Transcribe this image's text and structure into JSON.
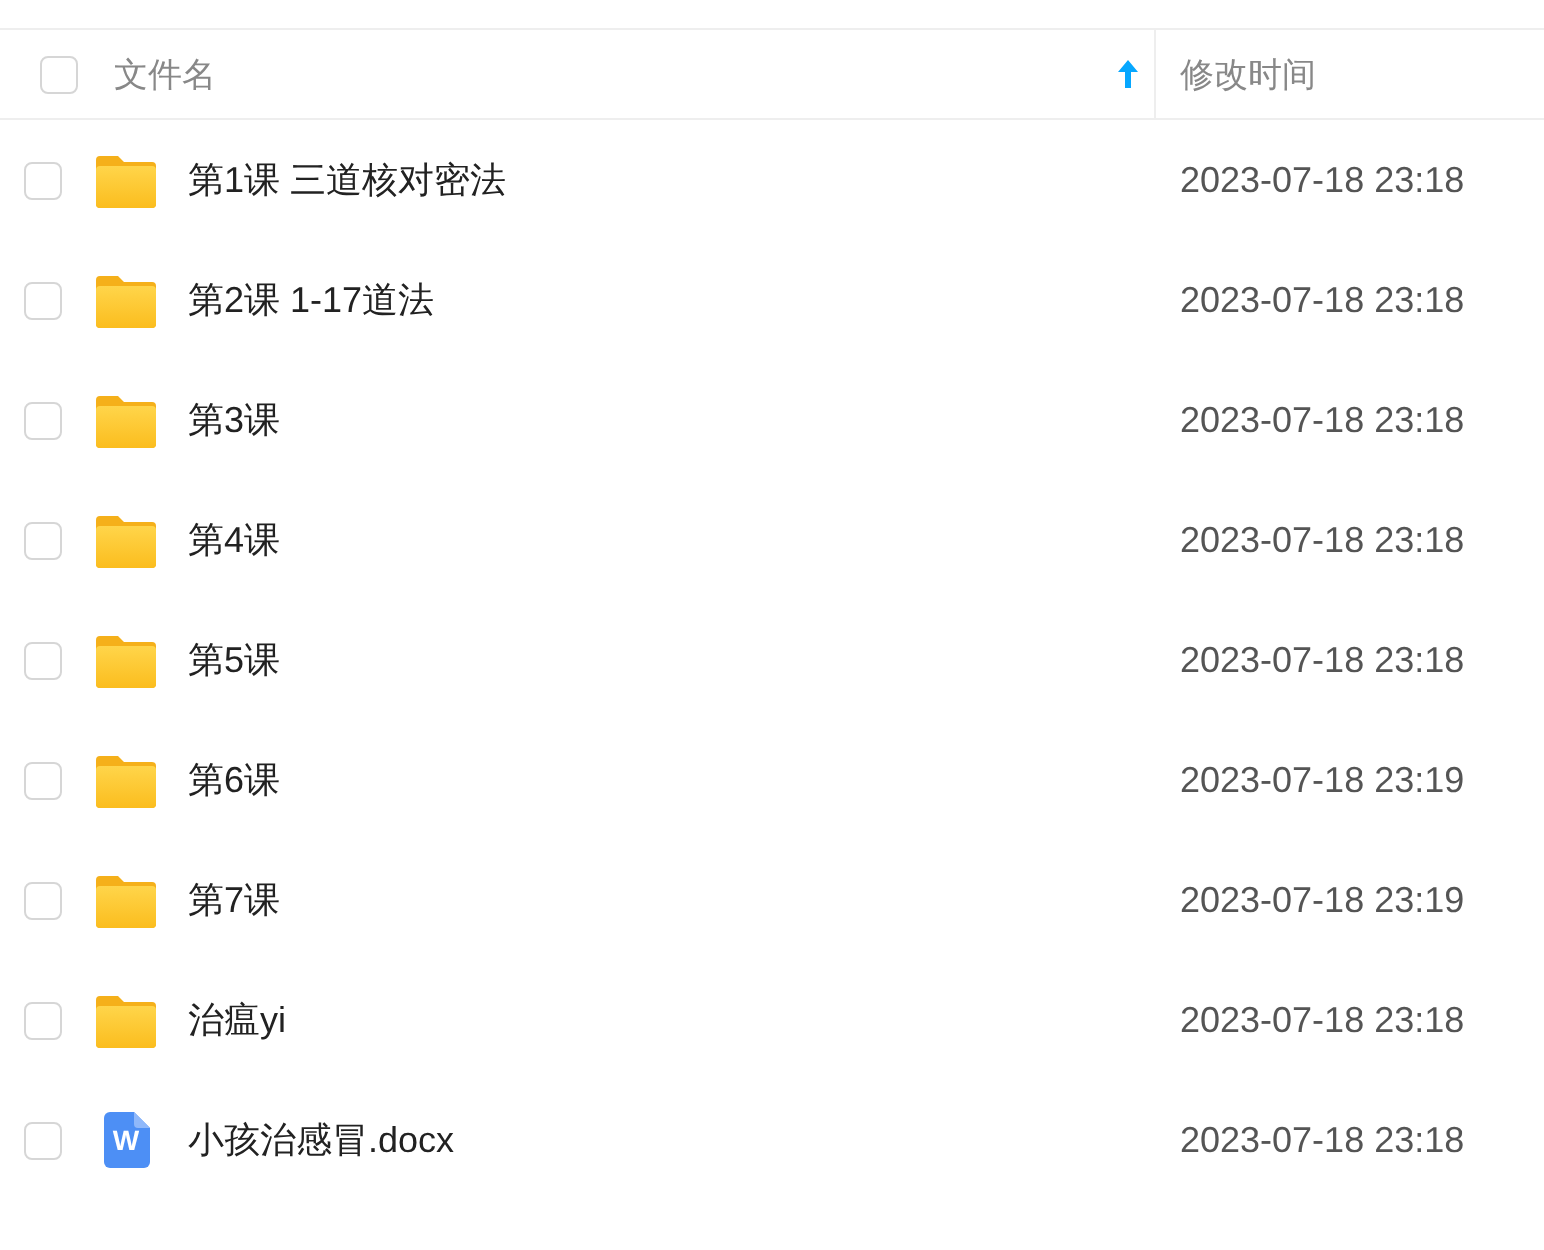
{
  "header": {
    "select_all_checked": false,
    "columns": [
      {
        "label": "文件名",
        "sort_ascending": true
      },
      {
        "label": "修改时间"
      }
    ]
  },
  "rows": [
    {
      "kind": "folder",
      "name": "第1课 三道核对密法",
      "modified": "2023-07-18 23:18",
      "checked": false
    },
    {
      "kind": "folder",
      "name": "第2课 1-17道法",
      "modified": "2023-07-18 23:18",
      "checked": false
    },
    {
      "kind": "folder",
      "name": "第3课",
      "modified": "2023-07-18 23:18",
      "checked": false
    },
    {
      "kind": "folder",
      "name": "第4课",
      "modified": "2023-07-18 23:18",
      "checked": false
    },
    {
      "kind": "folder",
      "name": "第5课",
      "modified": "2023-07-18 23:18",
      "checked": false
    },
    {
      "kind": "folder",
      "name": "第6课",
      "modified": "2023-07-18 23:19",
      "checked": false
    },
    {
      "kind": "folder",
      "name": "第7课",
      "modified": "2023-07-18 23:19",
      "checked": false
    },
    {
      "kind": "folder",
      "name": "治瘟yi",
      "modified": "2023-07-18 23:18",
      "checked": false
    },
    {
      "kind": "doc",
      "icon_text": "W",
      "name": "小孩治感冒.docx",
      "modified": "2023-07-18 23:18",
      "checked": false
    }
  ]
}
